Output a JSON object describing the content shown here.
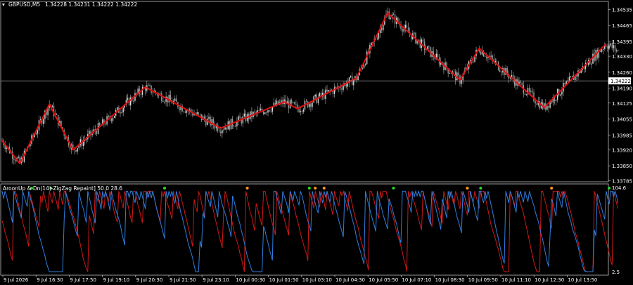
{
  "header": {
    "symbol": "GBPUSD,M5",
    "ohlc": "1.34228 1.34231 1.34222 1.34222"
  },
  "indicator_header": "AroonUp & Dn(14)-ZigZag Repaint] 50.0 28.6",
  "colors": {
    "background": "#000000",
    "candles": "#9a9a9a",
    "zigzag": "#e01010",
    "aroon_up": "#2f7fe0",
    "aroon_down": "#d01818",
    "marker_green": "#22dd22",
    "marker_orange": "#ff9922",
    "frame": "#c0c0c0",
    "price_tag_bg": "#ffffff",
    "price_tag_text": "#000000"
  },
  "chart_data": [
    {
      "type": "candlestick",
      "title": "GBPUSD,M5",
      "y_ticks": [
        "1.34535",
        "1.34465",
        "1.34395",
        "1.34330",
        "1.34260",
        "1.34190",
        "1.34125",
        "1.34055",
        "1.33985",
        "1.33920",
        "1.33850",
        "1.33785"
      ],
      "current_price": "1.34222",
      "ylim": [
        1.3378,
        1.3457
      ],
      "x_ticks": [
        "9 Jul 2026",
        "9 Jul 16:30",
        "9 Jul 17:50",
        "9 Jul 19:10",
        "9 Jul 20:30",
        "9 Jul 21:50",
        "9 Jul 23:10",
        "10 Jul 00:30",
        "10 Jul 01:50",
        "10 Jul 03:10",
        "10 Jul 04:30",
        "10 Jul 05:50",
        "10 Jul 07:10",
        "10 Jul 08:30",
        "10 Jul 09:50",
        "10 Jul 11:10",
        "10 Jul 12:30",
        "10 Jul 13:50"
      ],
      "zigzag": [
        {
          "bar": 0,
          "price": 1.3396
        },
        {
          "bar": 12,
          "price": 1.3386
        },
        {
          "bar": 32,
          "price": 1.3412
        },
        {
          "bar": 48,
          "price": 1.3392
        },
        {
          "bar": 97,
          "price": 1.34195
        },
        {
          "bar": 148,
          "price": 1.34015
        },
        {
          "bar": 191,
          "price": 1.3413
        },
        {
          "bar": 200,
          "price": 1.341
        },
        {
          "bar": 240,
          "price": 1.34235
        },
        {
          "bar": 261,
          "price": 1.3452
        },
        {
          "bar": 310,
          "price": 1.34225
        },
        {
          "bar": 323,
          "price": 1.34365
        },
        {
          "bar": 367,
          "price": 1.34105
        },
        {
          "bar": 409,
          "price": 1.34385
        }
      ]
    },
    {
      "type": "line",
      "title": "AroonUp & Dn(14)-ZigZag Repaint] 50.0 28.6",
      "y_ticks": [
        "104.6",
        "2.5"
      ],
      "ylim": [
        2.5,
        104.6
      ],
      "series": [
        {
          "name": "AroonUp",
          "color": "#2f7fe0"
        },
        {
          "name": "AroonDn",
          "color": "#d01818"
        }
      ],
      "markers": [
        {
          "bar": 20,
          "color": "green"
        },
        {
          "bar": 33,
          "color": "green"
        },
        {
          "bar": 110,
          "color": "green"
        },
        {
          "bar": 166,
          "color": "orange"
        },
        {
          "bar": 208,
          "color": "green"
        },
        {
          "bar": 212,
          "color": "orange"
        },
        {
          "bar": 218,
          "color": "orange"
        },
        {
          "bar": 265,
          "color": "green"
        },
        {
          "bar": 315,
          "color": "orange"
        },
        {
          "bar": 324,
          "color": "green"
        },
        {
          "bar": 372,
          "color": "orange"
        },
        {
          "bar": 411,
          "color": "green"
        }
      ]
    }
  ]
}
